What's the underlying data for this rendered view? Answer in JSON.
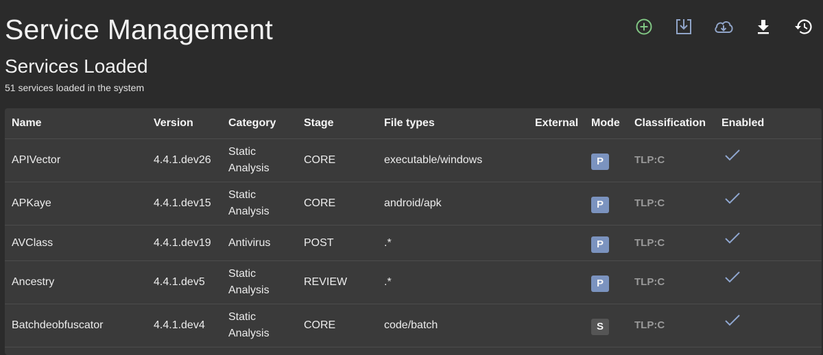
{
  "header": {
    "title": "Service Management",
    "section_title": "Services Loaded",
    "section_subtitle": "51 services loaded in the system"
  },
  "toolbar": [
    {
      "icon": "add-circle-icon",
      "color": "#81c784"
    },
    {
      "icon": "install-icon",
      "color": "#90a4c8"
    },
    {
      "icon": "cloud-download-icon",
      "color": "#90a4c8"
    },
    {
      "icon": "download-icon",
      "color": "#ffffff"
    },
    {
      "icon": "history-icon",
      "color": "#ffffff"
    }
  ],
  "table": {
    "columns": [
      "Name",
      "Version",
      "Category",
      "Stage",
      "File types",
      "External",
      "Mode",
      "Classification",
      "Enabled"
    ],
    "rows": [
      {
        "name": "APIVector",
        "version": "4.4.1.dev26",
        "category": "Static Analysis",
        "stage": "CORE",
        "file_types": "executable/windows",
        "external": "",
        "mode": "P",
        "classification": "TLP:C",
        "enabled": true
      },
      {
        "name": "APKaye",
        "version": "4.4.1.dev15",
        "category": "Static Analysis",
        "stage": "CORE",
        "file_types": "android/apk",
        "external": "",
        "mode": "P",
        "classification": "TLP:C",
        "enabled": true
      },
      {
        "name": "AVClass",
        "version": "4.4.1.dev19",
        "category": "Antivirus",
        "stage": "POST",
        "file_types": ".*",
        "external": "",
        "mode": "P",
        "classification": "TLP:C",
        "enabled": true
      },
      {
        "name": "Ancestry",
        "version": "4.4.1.dev5",
        "category": "Static Analysis",
        "stage": "REVIEW",
        "file_types": ".*",
        "external": "",
        "mode": "P",
        "classification": "TLP:C",
        "enabled": true
      },
      {
        "name": "Batchdeobfuscator",
        "version": "4.4.1.dev4",
        "category": "Static Analysis",
        "stage": "CORE",
        "file_types": "code/batch",
        "external": "",
        "mode": "S",
        "classification": "TLP:C",
        "enabled": true
      }
    ]
  },
  "colors": {
    "mode_P": "#7b93bf",
    "mode_S": "#555555",
    "check": "#8fa6cf"
  }
}
